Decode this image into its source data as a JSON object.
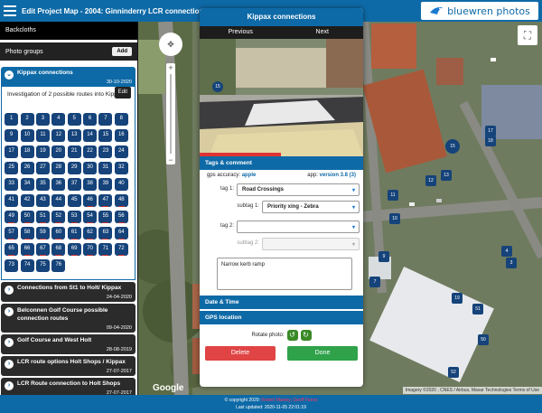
{
  "header": {
    "title": "Edit Project Map - 2004: Ginninderry LCR connections",
    "brand": "bluewren photos"
  },
  "sidebar": {
    "backcloths_label": "Backcloths",
    "photo_groups_label": "Photo groups",
    "add_label": "Add",
    "active_group": {
      "title": "Kippax connections",
      "date": "30-10-2020",
      "description": "Investigation of 2 possible routes into Kippax",
      "edit_label": "Edit",
      "photo_numbers": [
        "1",
        "2",
        "3",
        "4",
        "5",
        "6",
        "7",
        "8",
        "9",
        "10",
        "11",
        "12",
        "13",
        "14",
        "15",
        "16",
        "17",
        "18",
        "19",
        "20",
        "21",
        "22",
        "23",
        "24",
        "25",
        "26",
        "27",
        "28",
        "29",
        "30",
        "31",
        "32",
        "33",
        "34",
        "35",
        "36",
        "37",
        "38",
        "39",
        "40",
        "41",
        "42",
        "43",
        "44",
        "45",
        "46",
        "47",
        "48",
        "49",
        "50",
        "51",
        "52",
        "53",
        "54",
        "55",
        "56",
        "57",
        "58",
        "59",
        "60",
        "61",
        "62",
        "63",
        "64",
        "65",
        "66",
        "67",
        "68",
        "69",
        "70",
        "71",
        "72",
        "73",
        "74",
        "75",
        "76"
      ]
    },
    "groups": [
      {
        "title": "Connections from St1 to Holt/ Kippax",
        "date": "24-04-2020"
      },
      {
        "title": "Belconnen Golf Course possible connection routes",
        "date": "09-04-2020"
      },
      {
        "title": "Golf Course and West Holt",
        "date": "28-08-2019"
      },
      {
        "title": "LCR route options Holt Shops / Kippax",
        "date": "27-07-2017"
      },
      {
        "title": "LCR Route connection to Holt Shops",
        "date": "27-07-2017"
      }
    ]
  },
  "map": {
    "google_label": "Google",
    "credit": "Imagery ©2020 , CNES / Airbus, Maxar Technologies   Terms of Use",
    "markers": [
      "15",
      "17",
      "18",
      "12",
      "13",
      "11",
      "10",
      "9",
      "7",
      "4",
      "3",
      "50",
      "52",
      "51",
      "19"
    ],
    "zoom_in": "+",
    "zoom_out": "−"
  },
  "modal": {
    "title": "Kippax connections",
    "prev_label": "Previous",
    "next_label": "Next",
    "photo_marker": "15",
    "tags_section": "Tags & comment",
    "gps_accuracy_label": "gps accuracy:",
    "gps_accuracy_value": "apple",
    "app_label": "app:",
    "app_value": "version 3.8 (3)",
    "tag1_label": "tag 1:",
    "tag1_value": "Road Crossings",
    "subtag1_label": "subtag 1:",
    "subtag1_value": "Priority xing - Zebra",
    "tag2_label": "tag 2:",
    "tag2_value": "",
    "subtag2_label": "subtag 2:",
    "subtag2_value": "",
    "comment": "Narrow kerb ramp",
    "datetime_section": "Date & Time",
    "gps_section": "GPS location",
    "rotate_label": "Rotate photo:",
    "delete_label": "Delete",
    "done_label": "Done"
  },
  "footer": {
    "copyright": "© copyright 2020:",
    "authors": "Robert Manley, Geoff Farrar",
    "updated": "Last updated: 2020-11-05 22:01:19"
  },
  "colors": {
    "primary": "#0e6aa7",
    "marker": "#15437a",
    "delete": "#e04444",
    "done": "#2fa24a"
  }
}
